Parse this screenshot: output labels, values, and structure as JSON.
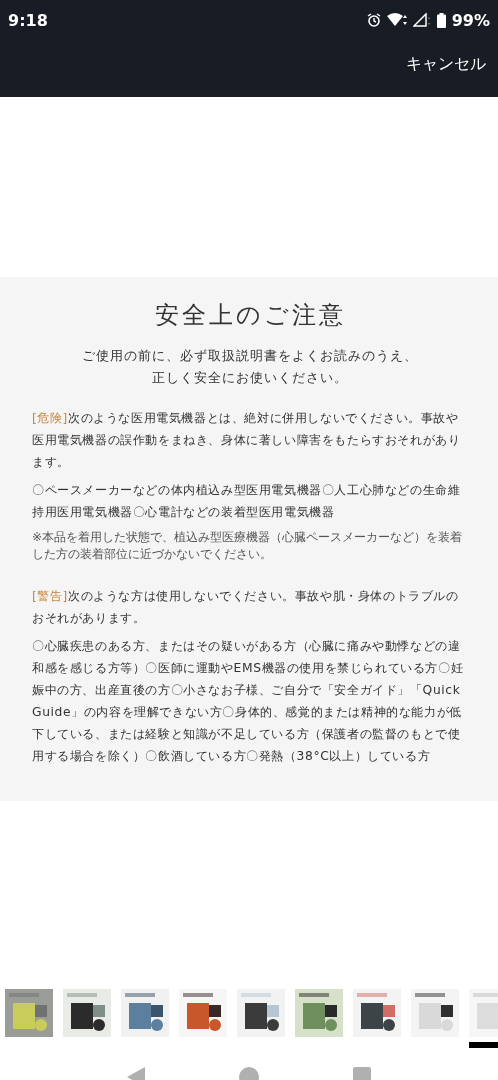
{
  "status_bar": {
    "time": "9:18",
    "battery": "99%"
  },
  "header": {
    "cancel": "キャンセル"
  },
  "notice": {
    "title": "安全上のご注意",
    "intro": [
      "ご使用の前に、必ず取扱説明書をよくお読みのうえ、",
      "正しく安全にお使いください。"
    ],
    "sections": [
      {
        "tag": "[危険]",
        "text": "次のような医用電気機器とは、絶対に併用しないでください。事故や医用電気機器の誤作動をまねき、身体に著しい障害をもたらすおそれがあります。",
        "items": "〇ペースメーカーなどの体内植込み型医用電気機器〇人工心肺などの生命維持用医用電気機器〇心電計などの装着型医用電気機器",
        "note": "※本品を着用した状態で、植込み型医療機器（心臓ペースメーカーなど）を装着した方の装着部位に近づかないでください。"
      },
      {
        "tag": "[警告]",
        "text": "次のような方は使用しないでください。事故や肌・身体のトラブルのおそれがあります。",
        "items": "〇心臓疾患のある方、またはその疑いがある方（心臓に痛みや動悸などの違和感を感じる方等）〇医師に運動やEMS機器の使用を禁じられている方〇妊娠中の方、出産直後の方〇小さなお子様、ご自分で「安全ガイド」「Quick Guide」の内容を理解できない方〇身体的、感覚的または精神的な能力が低下している、または経験と知識が不足している方（保護者の監督のもとで使用する場合を除く）〇飲酒している方〇発熱（38°C以上）している方"
      }
    ]
  },
  "thumbnails": [
    {
      "kind": "picture",
      "selected": false
    },
    {
      "kind": "picture",
      "selected": false
    },
    {
      "kind": "picture",
      "selected": false
    },
    {
      "kind": "picture",
      "selected": false
    },
    {
      "kind": "picture",
      "selected": false
    },
    {
      "kind": "picture",
      "selected": false
    },
    {
      "kind": "picture",
      "selected": false
    },
    {
      "kind": "picture",
      "selected": false
    },
    {
      "kind": "picture",
      "selected": true
    }
  ]
}
